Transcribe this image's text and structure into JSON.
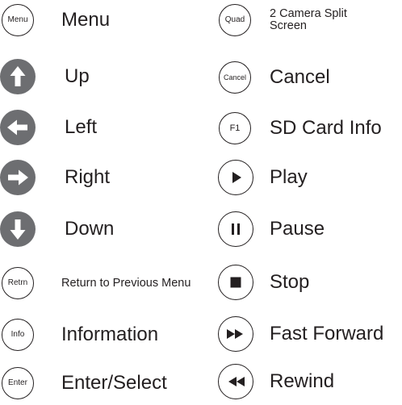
{
  "left_column": [
    {
      "button": "Menu",
      "label": "Menu",
      "icon": "menu-button-icon"
    },
    {
      "button": "",
      "label": "Up",
      "icon": "arrow-up-icon"
    },
    {
      "button": "",
      "label": "Left",
      "icon": "arrow-left-icon"
    },
    {
      "button": "",
      "label": "Right",
      "icon": "arrow-right-icon"
    },
    {
      "button": "",
      "label": "Down",
      "icon": "arrow-down-icon"
    },
    {
      "button": "Retrn",
      "label": "Return to Previous Menu",
      "icon": "return-button-icon"
    },
    {
      "button": "Info",
      "label": "Information",
      "icon": "info-button-icon"
    },
    {
      "button": "Enter",
      "label": "Enter/Select",
      "icon": "enter-button-icon"
    }
  ],
  "right_column": [
    {
      "button": "Quad",
      "label": "2 Camera Split Screen",
      "icon": "quad-button-icon"
    },
    {
      "button": "Cancel",
      "label": "Cancel",
      "icon": "cancel-button-icon"
    },
    {
      "button": "F1",
      "label": "SD Card Info",
      "icon": "f1-button-icon"
    },
    {
      "button": "",
      "label": "Play",
      "icon": "play-icon"
    },
    {
      "button": "",
      "label": "Pause",
      "icon": "pause-icon"
    },
    {
      "button": "",
      "label": "Stop",
      "icon": "stop-icon"
    },
    {
      "button": "",
      "label": "Fast Forward",
      "icon": "fast-forward-icon"
    },
    {
      "button": "",
      "label": "Rewind",
      "icon": "rewind-icon"
    }
  ],
  "colors": {
    "text": "#231f20",
    "filled_button": "#6d6e71",
    "background": "#ffffff"
  }
}
